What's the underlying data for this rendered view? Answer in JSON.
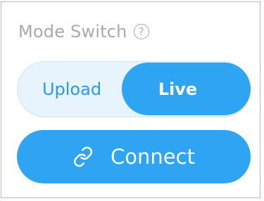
{
  "panel": {
    "title": "Mode Switch",
    "help_icon_label": "?"
  },
  "mode_switch": {
    "options": [
      {
        "label": "Upload",
        "selected": false
      },
      {
        "label": "Live",
        "selected": true
      }
    ]
  },
  "connect_button": {
    "label": "Connect",
    "icon": "link-icon"
  },
  "colors": {
    "accent": "#2ea4f3",
    "track": "#e7f3fd",
    "muted_text": "#a7aaae"
  }
}
